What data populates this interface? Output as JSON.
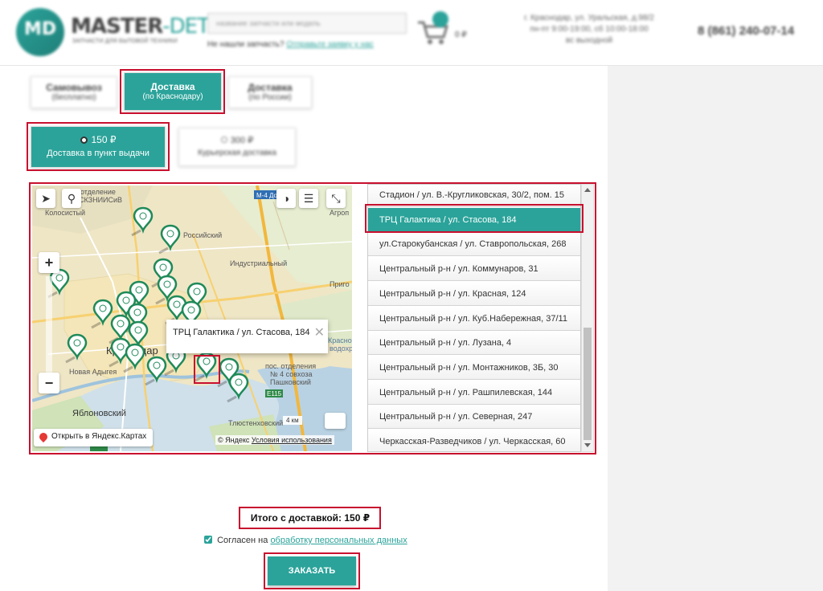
{
  "header": {
    "logo_mark": "MD",
    "logo_name_a": "MASTER",
    "logo_name_b": "-DETAL",
    "logo_tagline": "ЗАПЧАСТИ ДЛЯ БЫТОВОЙ ТЕХНИКИ",
    "search_placeholder": "название запчасти или модель",
    "not_found_text": "Не нашли запчасть?",
    "not_found_link": "Отправьте заявку у нас",
    "cart_price": "0 ₽",
    "address_line1": "г. Краснодар, ул. Уральская, д.98/2",
    "address_line2": "пн-пт 9:00-19:00, сб 10:00-18:00",
    "address_line3": "вс выходной",
    "phone": "8 (861) 240-07-14"
  },
  "delivery_types": [
    {
      "line1": "Самовывоз",
      "line2": "(бесплатно)",
      "active": false
    },
    {
      "line1": "Доставка",
      "line2": "(по Краснодару)",
      "active": true
    },
    {
      "line1": "Доставка",
      "line2": "(по России)",
      "active": false
    }
  ],
  "delivery_methods": [
    {
      "price": "150 ₽",
      "label": "Доставка в пункт выдачи",
      "active": true
    },
    {
      "price": "300 ₽",
      "label": "Курьерская доставка",
      "active": false
    }
  ],
  "map": {
    "labels": {
      "otdelenie": "отделение",
      "ksk": "СКЗНИИСиВ",
      "kolosisty": "Колосистый",
      "rossiysky": "Российский",
      "industrialny": "Индустриальный",
      "prigor": "Приго",
      "agrop": "Агроп",
      "krasnodar": "Краснодар",
      "novaya_adygeya": "Новая Адыгея",
      "yablonovsky": "Яблоновский",
      "pos_otd": "пос. отделения",
      "sovkhoz": "№ 4 совхоза",
      "pashkovsky": "Пашковский",
      "krasno": "Красно",
      "vodohr": "водохр",
      "tyutenskaya": "Тлюстенховский",
      "road_m4": "М-4 Дон",
      "road_e115": "E115"
    },
    "balloon_text": "ТРЦ Галактика / ул. Стасова, 184",
    "open_yandex": "Открыть в Яндекс.Картах",
    "copyright": "© Яндекс",
    "terms_link": "Условия использования",
    "scale_text": "4 км",
    "zoom_in": "+",
    "zoom_out": "−"
  },
  "pickup_points": [
    "Стадион / ул. В.-Кругликовская, 30/2, пом. 15",
    "ТРЦ Галактика / ул. Стасова, 184",
    "ул.Старокубанская / ул. Ставропольская, 268",
    "Центральный р-н / ул. Коммунаров, 31",
    "Центральный р-н / ул. Красная, 124",
    "Центральный р-н / ул. Куб.Набережная, 37/11",
    "Центральный р-н / ул. Лузана, 4",
    "Центральный р-н / ул. Монтажников, 3Б, 30",
    "Центральный р-н / ул. Рашпилевская, 144",
    "Центральный р-н / ул. Северная, 247",
    "Черкасская-Разведчиков / ул. Черкасская, 60"
  ],
  "selected_point_index": 1,
  "total_label": "Итого с доставкой: 150 ₽",
  "agree": {
    "prefix": "Согласен на ",
    "link": "обработку персональных данных",
    "checked": true
  },
  "order_button": "ЗАКАЗАТЬ",
  "colors": {
    "accent": "#2ba39a",
    "highlight": "#c8102e"
  }
}
